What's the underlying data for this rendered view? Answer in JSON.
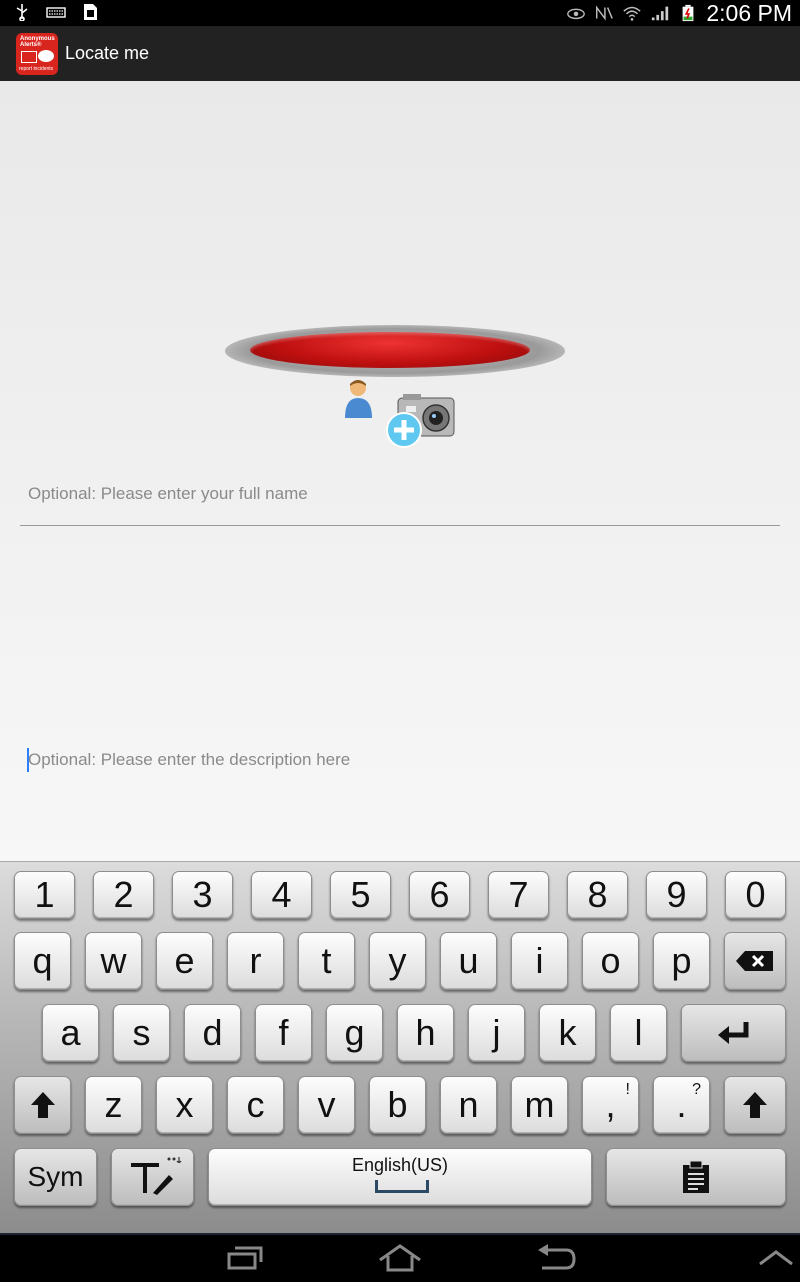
{
  "status_bar": {
    "time": "2:06 PM",
    "left_icons": [
      "usb-icon",
      "keyboard-icon",
      "sim-icon"
    ],
    "right_icons": [
      "eye-icon",
      "nfc-icon",
      "wifi-icon",
      "signal-icon",
      "battery-charging-icon"
    ]
  },
  "action_bar": {
    "app_icon_text": "Anonymous Alerts®",
    "app_icon_subtext": "report incidents",
    "title": "Locate me"
  },
  "form": {
    "name_placeholder": "Optional: Please enter your full name",
    "description_placeholder": "Optional: Please enter the description here"
  },
  "keyboard": {
    "number_row": [
      "1",
      "2",
      "3",
      "4",
      "5",
      "6",
      "7",
      "8",
      "9",
      "0"
    ],
    "row1": [
      "q",
      "w",
      "e",
      "r",
      "t",
      "y",
      "u",
      "i",
      "o",
      "p"
    ],
    "row2": [
      "a",
      "s",
      "d",
      "f",
      "g",
      "h",
      "j",
      "k",
      "l"
    ],
    "row3": [
      "z",
      "x",
      "c",
      "v",
      "b",
      "n",
      "m"
    ],
    "comma_key": ",",
    "comma_sub": "!",
    "period_key": ".",
    "period_sub": "?",
    "sym_label": "Sym",
    "space_label": "English(US)"
  },
  "colors": {
    "accent_red": "#c01010",
    "action_bar": "#222222",
    "content_bg": "#efefef"
  }
}
